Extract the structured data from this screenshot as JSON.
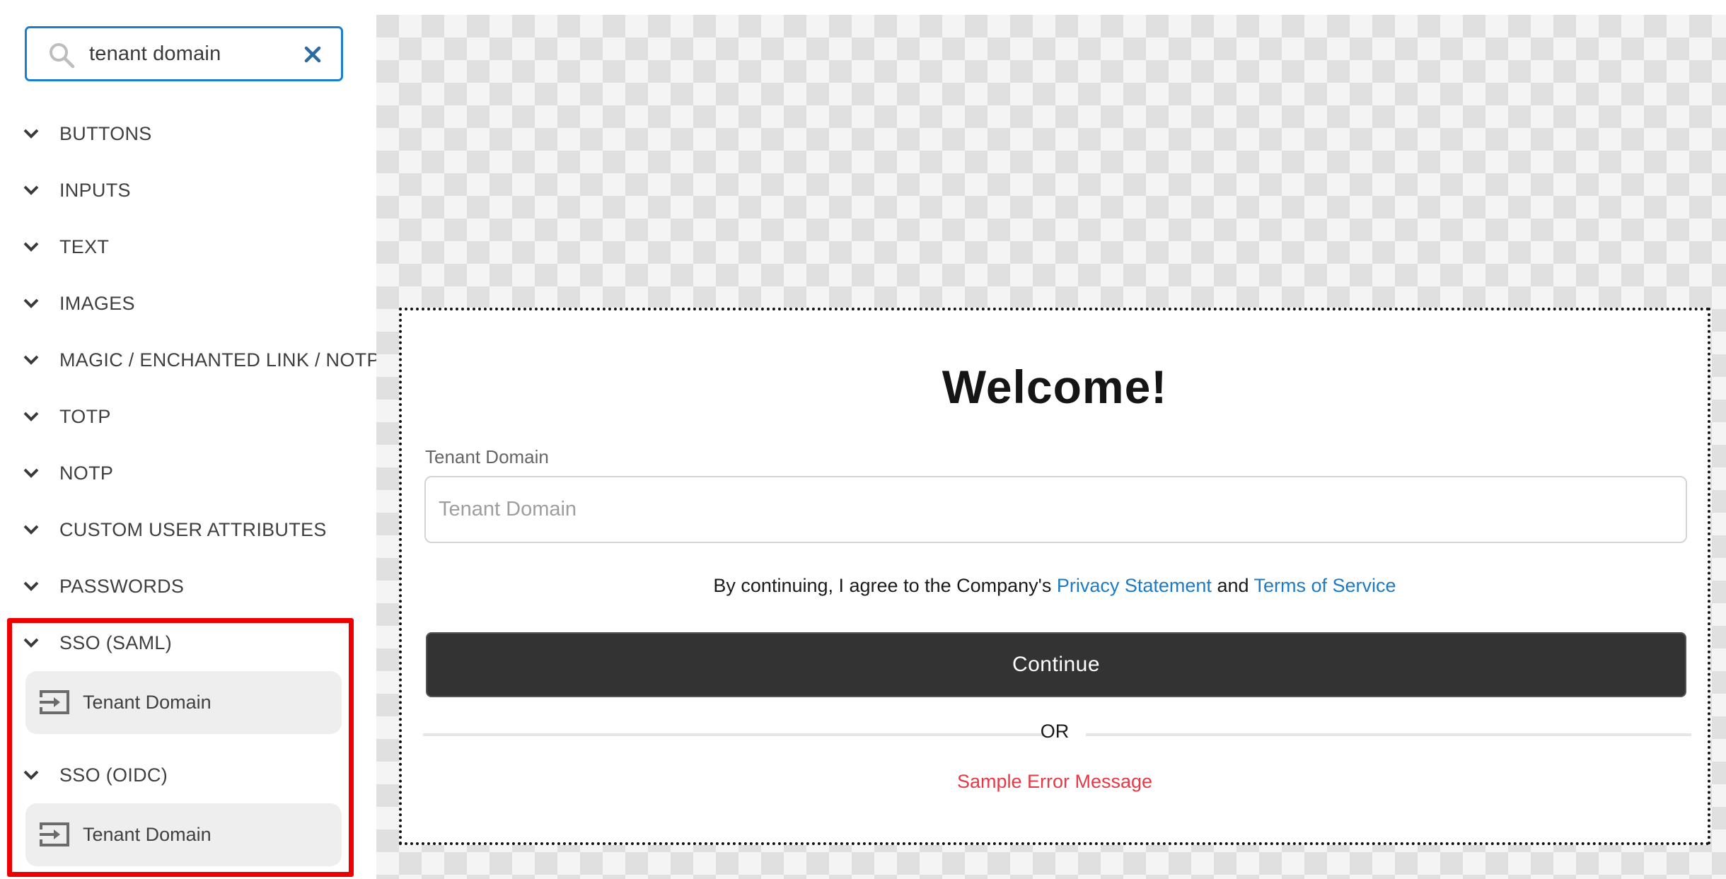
{
  "sidebar": {
    "search": {
      "value": "tenant domain",
      "icon": "search-icon",
      "clear_icon": "close-icon"
    },
    "sections": [
      {
        "label": "BUTTONS",
        "icon": "chevron-down-icon"
      },
      {
        "label": "INPUTS",
        "icon": "chevron-down-icon"
      },
      {
        "label": "TEXT",
        "icon": "chevron-down-icon"
      },
      {
        "label": "IMAGES",
        "icon": "chevron-down-icon"
      },
      {
        "label": "MAGIC / ENCHANTED LINK / NOTP",
        "icon": "chevron-down-icon"
      },
      {
        "label": "TOTP",
        "icon": "chevron-down-icon"
      },
      {
        "label": "NOTP",
        "icon": "chevron-down-icon"
      },
      {
        "label": "CUSTOM USER ATTRIBUTES",
        "icon": "chevron-down-icon"
      },
      {
        "label": "PASSWORDS",
        "icon": "chevron-down-icon"
      },
      {
        "label": "SSO (SAML)",
        "icon": "chevron-down-icon",
        "items": [
          {
            "label": "Tenant Domain",
            "icon": "input-login-icon"
          }
        ]
      },
      {
        "label": "SSO (OIDC)",
        "icon": "chevron-down-icon",
        "items": [
          {
            "label": "Tenant Domain",
            "icon": "input-login-icon"
          }
        ]
      }
    ]
  },
  "canvas": {
    "title": "Welcome!",
    "field": {
      "label": "Tenant Domain",
      "value": "",
      "placeholder": "Tenant Domain"
    },
    "consent": {
      "prefix": "By continuing, I agree to the Company's ",
      "privacy_link": "Privacy Statement",
      "joiner": " and ",
      "terms_link": "Terms of Service"
    },
    "continue_label": "Continue",
    "divider_text": "OR",
    "error_message": "Sample Error Message"
  },
  "colors": {
    "accent": "#1a7fcf",
    "link": "#1d7ac7",
    "error": "#e63946",
    "button_bg": "#333333",
    "highlight": "#ee0000"
  }
}
